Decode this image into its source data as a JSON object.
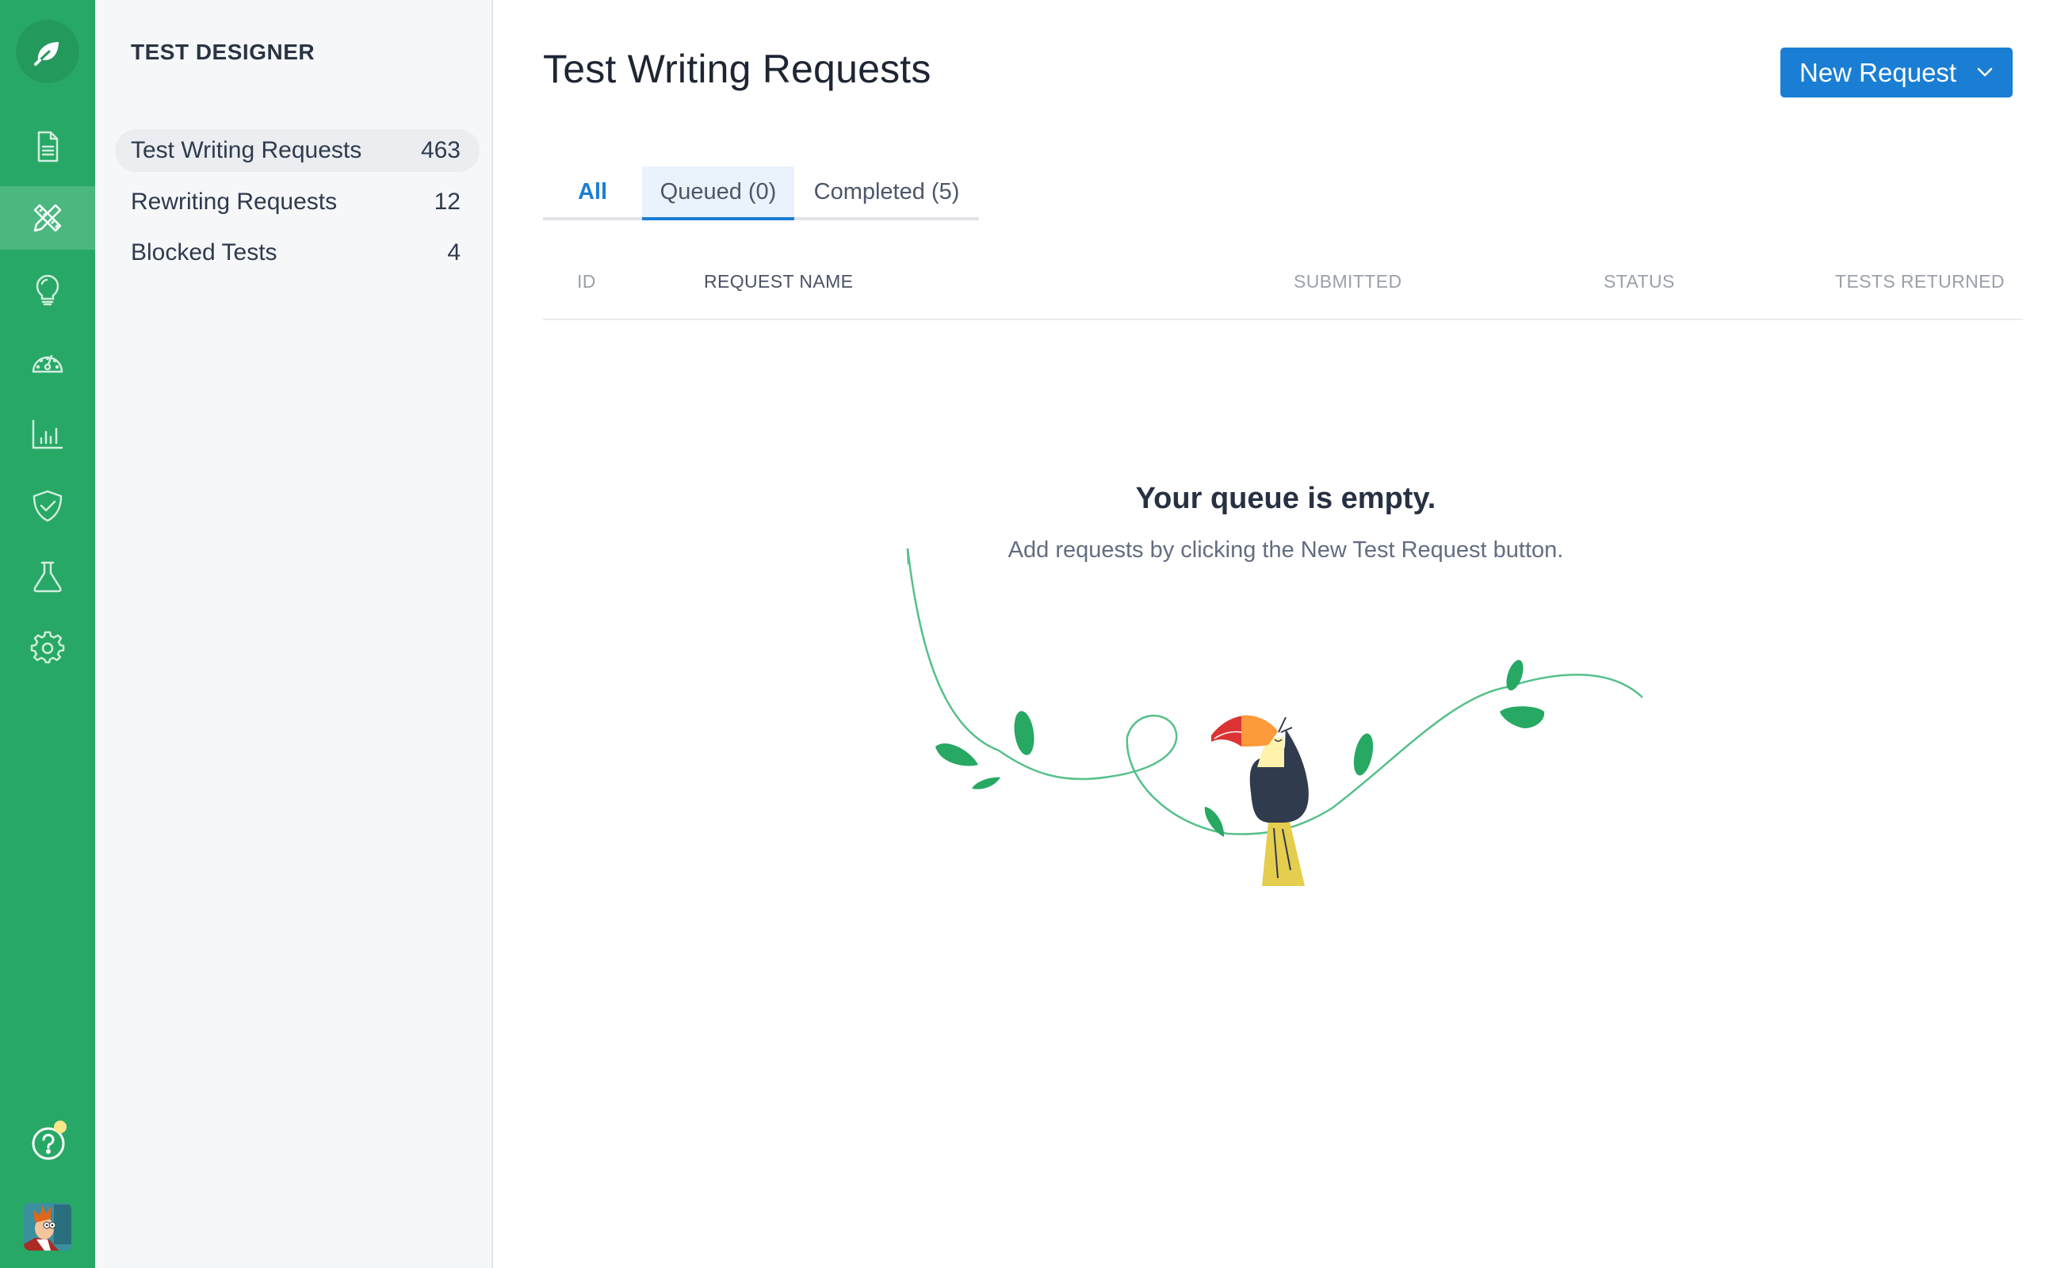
{
  "app": {
    "logo_icon": "leaf-icon"
  },
  "rail": {
    "items": [
      {
        "name": "documents",
        "icon": "document-icon",
        "active": false
      },
      {
        "name": "test-designer",
        "icon": "ruler-pencil-icon",
        "active": true
      },
      {
        "name": "ideas",
        "icon": "lightbulb-icon",
        "active": false
      },
      {
        "name": "performance",
        "icon": "speedometer-icon",
        "active": false
      },
      {
        "name": "analytics",
        "icon": "bar-chart-icon",
        "active": false
      },
      {
        "name": "security",
        "icon": "shield-check-icon",
        "active": false
      },
      {
        "name": "lab",
        "icon": "flask-icon",
        "active": false
      },
      {
        "name": "settings",
        "icon": "gear-icon",
        "active": false
      }
    ],
    "help_icon": "help-icon",
    "help_has_notification": true,
    "avatar": "user-avatar"
  },
  "subnav": {
    "title": "TEST DESIGNER",
    "items": [
      {
        "label": "Test Writing Requests",
        "count": "463",
        "active": true
      },
      {
        "label": "Rewriting Requests",
        "count": "12",
        "active": false
      },
      {
        "label": "Blocked Tests",
        "count": "4",
        "active": false
      }
    ]
  },
  "main": {
    "title": "Test Writing Requests",
    "new_request_label": "New Request",
    "tabs": [
      {
        "label": "All"
      },
      {
        "label": "Queued (0)",
        "selected": true
      },
      {
        "label": "Completed (5)"
      }
    ],
    "table": {
      "columns": [
        "ID",
        "REQUEST NAME",
        "SUBMITTED",
        "STATUS",
        "TESTS RETURNED"
      ],
      "rows": []
    },
    "empty_state": {
      "title": "Your queue is empty.",
      "subtitle": "Add requests by clicking the New Test Request button.",
      "illustration": "toucan-on-vine"
    }
  },
  "colors": {
    "rail_green": "#28a866",
    "accent_blue": "#1a7ed4",
    "leaf_green": "#27a863",
    "vine_green": "#55c08a"
  }
}
